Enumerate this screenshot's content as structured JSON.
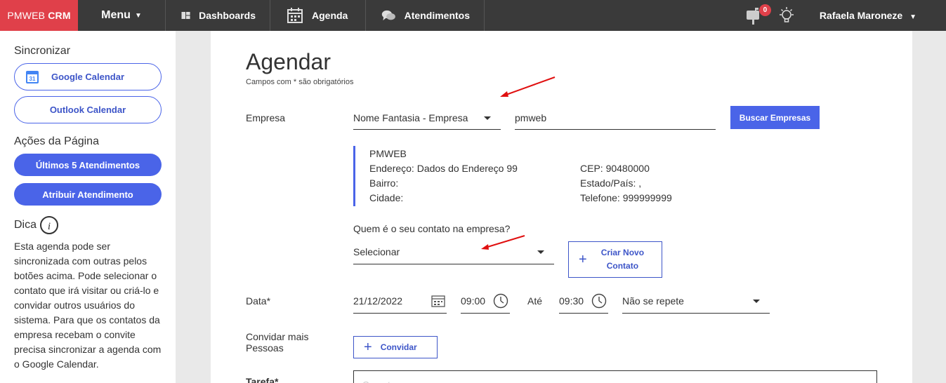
{
  "topbar": {
    "brand_left": "PMWEB",
    "brand_right": "CRM",
    "menu_label": "Menu",
    "nav": [
      {
        "label": "Dashboards",
        "icon": "dashboard-icon"
      },
      {
        "label": "Agenda",
        "icon": "calendar-icon"
      },
      {
        "label": "Atendimentos",
        "icon": "chat-icon"
      }
    ],
    "notification_count": "0",
    "user_name": "Rafaela Maroneze"
  },
  "sidebar": {
    "sync_heading": "Sincronizar",
    "google_calendar": "Google Calendar",
    "google_calendar_day": "31",
    "outlook_calendar": "Outlook Calendar",
    "actions_heading": "Ações da Página",
    "last_attendances": "Últimos 5 Atendimentos",
    "assign_attendance": "Atribuir Atendimento",
    "tip_heading": "Dica",
    "tip_text": "Esta agenda pode ser sincronizada com outras pelos botões acima. Pode selecionar o contato que irá visitar ou criá-lo e convidar outros usuários do sistema. Para que os contatos da empresa recebam o convite precisa sincronizar a agenda com o Google Calendar."
  },
  "form": {
    "title": "Agendar",
    "subtitle": "Campos com * são obrigatórios",
    "empresa_label": "Empresa",
    "empresa_filter": "Nome Fantasia - Empresa",
    "empresa_search_value": "pmweb",
    "search_button": "Buscar Empresas",
    "company": {
      "name": "PMWEB",
      "address": "Endereço: Dados do Endereço 99",
      "neighborhood": "Bairro:",
      "city": "Cidade:",
      "cep": "CEP: 90480000",
      "state": "Estado/País: ,",
      "phone": "Telefone: 999999999"
    },
    "contact_question": "Quem é o seu contato na empresa?",
    "contact_select": "Selecionar",
    "new_contact_line1": "Criar Novo",
    "new_contact_line2": "Contato",
    "date_label": "Data*",
    "date_value": "21/12/2022",
    "start_time": "09:00",
    "until_label": "Até",
    "end_time": "09:30",
    "repeat_value": "Não se repete",
    "invite_label_line1": "Convidar mais",
    "invite_label_line2": "Pessoas",
    "invite_button": "Convidar",
    "task_label": "Tarefa*",
    "task_placeholder": "Gerente"
  },
  "colors": {
    "brand_red": "#e0404a",
    "topbar": "#3a3a3a",
    "accent_blue": "#4a64e8",
    "annotation_red": "#e01010"
  }
}
